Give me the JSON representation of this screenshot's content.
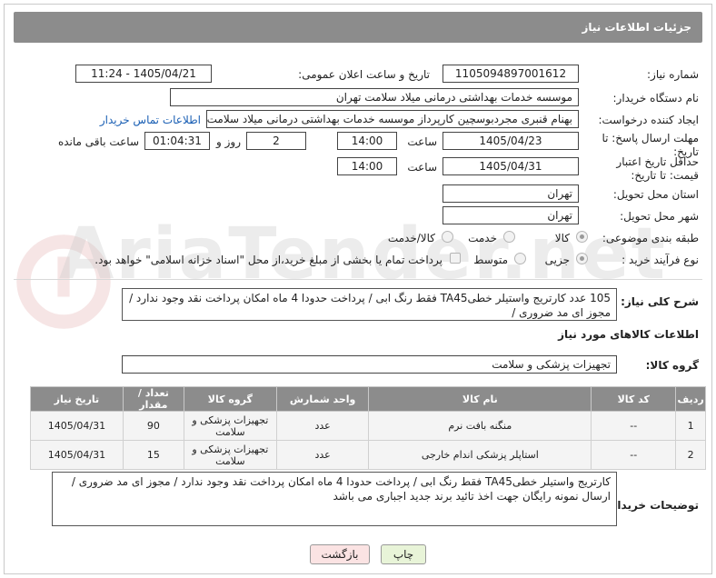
{
  "header": {
    "title": "جزئیات اطلاعات نیاز"
  },
  "fields": {
    "need_number_label": "شماره نیاز:",
    "need_number": "1105094897001612",
    "announce_label": "تاریخ و ساعت اعلان عمومی:",
    "announce_value": "1405/04/21 - 11:24",
    "buyer_org_label": "نام دستگاه خریدار:",
    "buyer_org": "موسسه خدمات بهداشتی درمانی میلاد سلامت تهران",
    "requester_label": "ایجاد کننده درخواست:",
    "requester": "بهنام قنبری مجردبوسچین کارپرداز موسسه خدمات بهداشتی درمانی میلاد سلامت تهران",
    "buyer_contact_link": "اطلاعات تماس خریدار",
    "deadline_label": "مهلت ارسال پاسخ: تا تاریخ:",
    "deadline_date": "1405/04/23",
    "time_label": "ساعت",
    "deadline_time": "14:00",
    "days_count": "2",
    "day_and_label": "روز و",
    "remaining_time": "01:04:31",
    "remaining_label": "ساعت باقی مانده",
    "validity_label": "حداقل تاریخ اعتبار قیمت: تا تاریخ:",
    "validity_date": "1405/04/31",
    "validity_time": "14:00",
    "province_label": "استان محل تحویل:",
    "province": "تهران",
    "city_label": "شهر محل تحویل:",
    "city": "تهران",
    "category_label": "طبقه بندی موضوعی:",
    "category_options": [
      "کالا",
      "خدمت",
      "کالا/خدمت"
    ],
    "process_label": "نوع فرآیند خرید :",
    "process_options": [
      "جزیی",
      "متوسط"
    ],
    "payment_note": "پرداخت تمام یا بخشی از مبلغ خرید،از محل \"اسناد خزانه اسلامی\" خواهد بود.",
    "summary_label": "شرح کلی نیاز:",
    "summary": "105 عدد کارتریج واستیلر خطیTA45 فقط رنگ ابی  /  پرداخت حدودا  4 ماه  امکان پرداخت نقد وجود ندارد / مجوز ای مد ضروری /",
    "goods_info_title": "اطلاعات کالاهای مورد نیاز",
    "goods_group_label": "گروه کالا:",
    "goods_group": "تجهیزات پزشکی و سلامت"
  },
  "table": {
    "headers": [
      "ردیف",
      "کد کالا",
      "نام کالا",
      "واحد شمارش",
      "گروه کالا",
      "تعداد / مقدار",
      "تاریخ نیاز"
    ],
    "rows": [
      [
        "1",
        "--",
        "منگنه بافت نرم",
        "عدد",
        "تجهیزات پزشکی و سلامت",
        "90",
        "1405/04/31"
      ],
      [
        "2",
        "--",
        "استاپلر پزشکی اندام خارجی",
        "عدد",
        "تجهیزات پزشکی و سلامت",
        "15",
        "1405/04/31"
      ]
    ]
  },
  "buyer_notes": {
    "label": "توضیحات خریدار:",
    "text": "کارتریج واستیلر خطیTA45 فقط رنگ ابی  /  پرداخت حدودا  4 ماه  امکان پرداخت نقد وجود ندارد / مجوز ای مد ضروری / ارسال نمونه رایگان جهت اخذ تائید برند جدید اجباری می باشد"
  },
  "buttons": {
    "print": "چاپ",
    "back": "بازگشت"
  },
  "watermark": {
    "text": "AriaTender.net"
  },
  "colors": {
    "header_bg": "#8c8c8c",
    "link": "#1a5fb4"
  }
}
